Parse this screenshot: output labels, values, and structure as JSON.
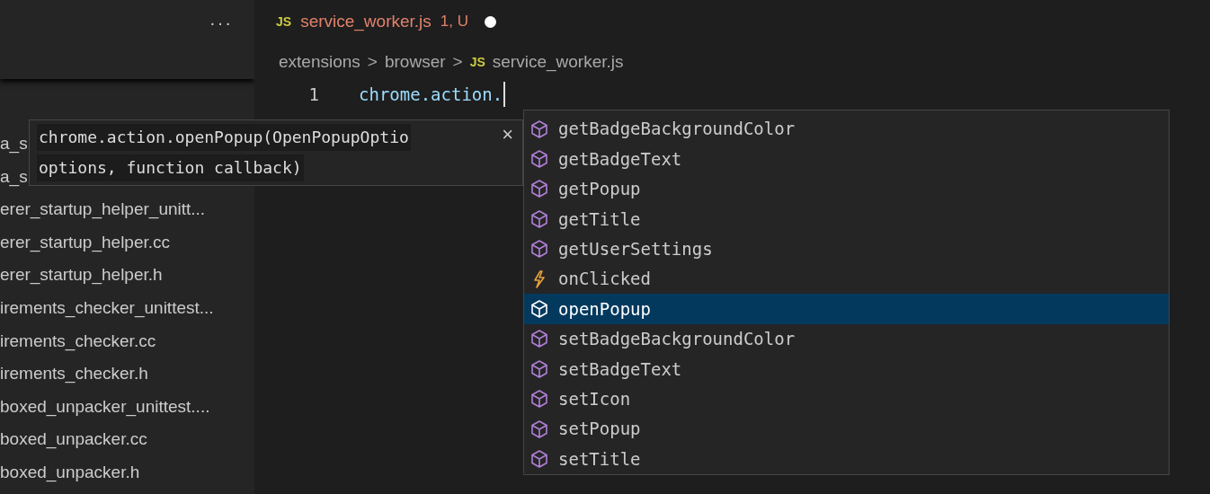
{
  "sidebar": {
    "more": "···",
    "items": [
      {
        "name": "a_s"
      },
      {
        "name": "a_s"
      },
      {
        "name": "erer_startup_helper_unitt..."
      },
      {
        "name": "erer_startup_helper.cc"
      },
      {
        "name": "erer_startup_helper.h"
      },
      {
        "name": "irements_checker_unittest..."
      },
      {
        "name": "irements_checker.cc"
      },
      {
        "name": "irements_checker.h"
      },
      {
        "name": "boxed_unpacker_unittest...."
      },
      {
        "name": "boxed_unpacker.cc"
      },
      {
        "name": "boxed_unpacker.h"
      }
    ]
  },
  "tab": {
    "icon": "JS",
    "title": "service_worker.js",
    "badge": "1, U",
    "modified": true
  },
  "breadcrumbs": [
    {
      "text": "extensions"
    },
    {
      "text": "browser"
    },
    {
      "text": "service_worker.js",
      "icon": "JS"
    }
  ],
  "separator": ">",
  "editor": {
    "line_number": "1",
    "code": "chrome.action."
  },
  "tooltip": {
    "lines": [
      "chrome.action.openPopup(OpenPopupOptio",
      "options, function callback)"
    ],
    "close": "×"
  },
  "suggestions": [
    {
      "label": "getBadgeBackgroundColor",
      "kind": "method",
      "selected": false
    },
    {
      "label": "getBadgeText",
      "kind": "method",
      "selected": false
    },
    {
      "label": "getPopup",
      "kind": "method",
      "selected": false
    },
    {
      "label": "getTitle",
      "kind": "method",
      "selected": false
    },
    {
      "label": "getUserSettings",
      "kind": "method",
      "selected": false
    },
    {
      "label": "onClicked",
      "kind": "event",
      "selected": false
    },
    {
      "label": "openPopup",
      "kind": "method",
      "selected": true
    },
    {
      "label": "setBadgeBackgroundColor",
      "kind": "method",
      "selected": false
    },
    {
      "label": "setBadgeText",
      "kind": "method",
      "selected": false
    },
    {
      "label": "setIcon",
      "kind": "method",
      "selected": false
    },
    {
      "label": "setPopup",
      "kind": "method",
      "selected": false
    },
    {
      "label": "setTitle",
      "kind": "method",
      "selected": false
    }
  ]
}
